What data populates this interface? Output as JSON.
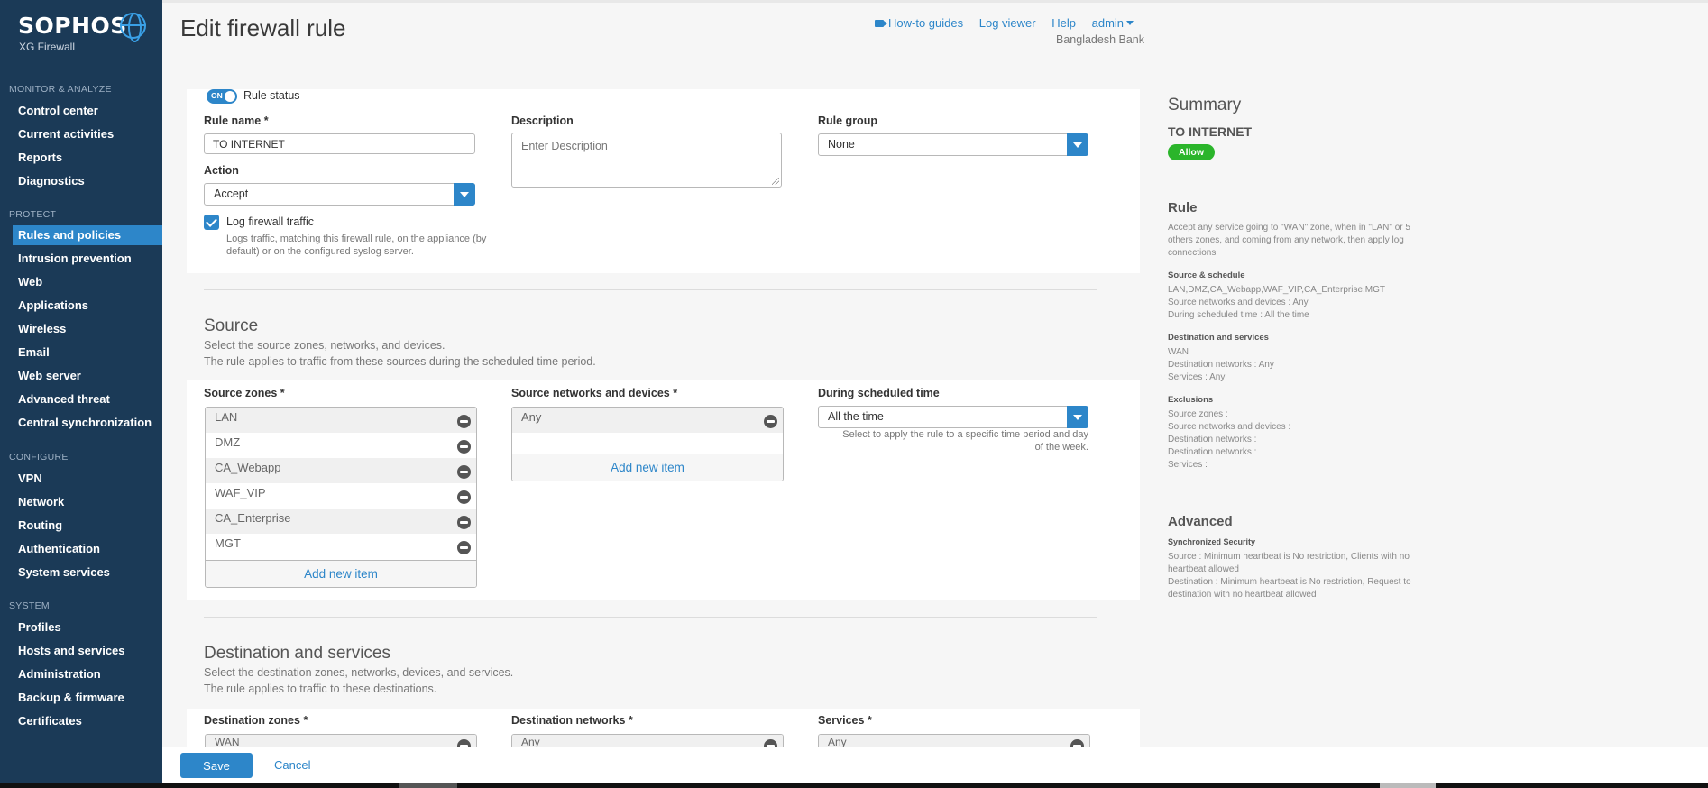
{
  "app": {
    "brand": "SOPHOS",
    "product": "XG Firewall"
  },
  "sidebar": {
    "sections": [
      {
        "heading": "MONITOR & ANALYZE",
        "items": [
          "Control center",
          "Current activities",
          "Reports",
          "Diagnostics"
        ]
      },
      {
        "heading": "PROTECT",
        "items": [
          "Rules and policies",
          "Intrusion prevention",
          "Web",
          "Applications",
          "Wireless",
          "Email",
          "Web server",
          "Advanced threat",
          "Central synchronization"
        ]
      },
      {
        "heading": "CONFIGURE",
        "items": [
          "VPN",
          "Network",
          "Routing",
          "Authentication",
          "System services"
        ]
      },
      {
        "heading": "SYSTEM",
        "items": [
          "Profiles",
          "Hosts and services",
          "Administration",
          "Backup & firmware",
          "Certificates"
        ]
      }
    ],
    "active_item": "Rules and policies"
  },
  "header": {
    "title": "Edit firewall rule",
    "links": {
      "howto": "How-to guides",
      "log_viewer": "Log viewer",
      "help": "Help",
      "user": "admin"
    },
    "org": "Bangladesh Bank"
  },
  "rule": {
    "status_toggle": "ON",
    "status_label": "Rule status",
    "name_label": "Rule name",
    "name_value": "TO INTERNET",
    "description_label": "Description",
    "description_placeholder": "Enter Description",
    "group_label": "Rule group",
    "group_value": "None",
    "action_label": "Action",
    "action_value": "Accept",
    "log_label": "Log firewall traffic",
    "log_checked": true,
    "log_hint": "Logs traffic, matching this firewall rule, on the appliance (by default) or on the configured syslog server."
  },
  "source": {
    "title": "Source",
    "desc1": "Select the source zones, networks, and devices.",
    "desc2": "The rule applies to traffic from these sources during the scheduled time period.",
    "zones_label": "Source zones",
    "zones": [
      "LAN",
      "DMZ",
      "CA_Webapp",
      "WAF_VIP",
      "CA_Enterprise",
      "MGT"
    ],
    "zones_add": "Add new item",
    "networks_label": "Source networks and devices",
    "networks": [
      "Any"
    ],
    "networks_add": "Add new item",
    "schedule_label": "During scheduled time",
    "schedule_value": "All the time",
    "schedule_hint": "Select to apply the rule to a specific time period and day of the week."
  },
  "destination": {
    "title": "Destination and services",
    "desc1": "Select the destination zones, networks, devices, and services.",
    "desc2": "The rule applies to traffic to these destinations.",
    "zones_label": "Destination zones",
    "zones_first": "WAN",
    "networks_label": "Destination networks",
    "networks_first": "Any",
    "services_label": "Services",
    "services_first": "Any"
  },
  "summary": {
    "title": "Summary",
    "rule_name": "TO INTERNET",
    "badge": "Allow",
    "rule_head": "Rule",
    "rule_text": "Accept any service going to \"WAN\" zone, when in \"LAN\" or 5 others zones, and coming from any network, then apply log connections",
    "src_head": "Source & schedule",
    "src_lines": [
      "LAN,DMZ,CA_Webapp,WAF_VIP,CA_Enterprise,MGT",
      "Source networks and devices : Any",
      "During scheduled time : All the time"
    ],
    "dst_head": "Destination and services",
    "dst_lines": [
      "WAN",
      "Destination networks : Any",
      "Services : Any"
    ],
    "exc_head": "Exclusions",
    "exc_lines": [
      "Source zones :",
      "Source networks and devices :",
      "Destination networks :",
      "Destination networks :",
      "Services :"
    ],
    "adv_head": "Advanced",
    "adv_small": "Synchronized Security",
    "adv_src": "Source : Minimum heartbeat is No restriction, Clients with no heartbeat allowed",
    "adv_dst": "Destination : Minimum heartbeat is No restriction, Request to destination with no heartbeat allowed"
  },
  "footer": {
    "save": "Save",
    "cancel": "Cancel"
  },
  "colors": {
    "sidebar": "#1b3a57",
    "accent": "#2d86c9",
    "allow": "#2bb52b"
  }
}
